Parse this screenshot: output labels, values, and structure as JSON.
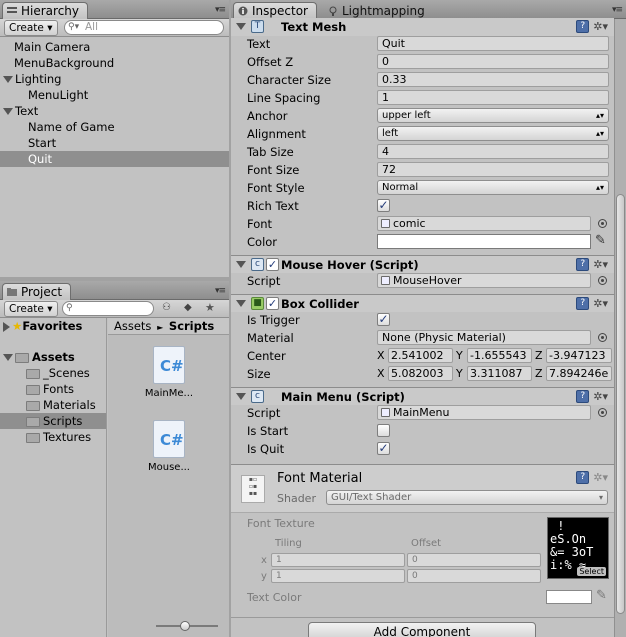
{
  "hierarchy": {
    "tab_label": "Hierarchy",
    "create_label": "Create",
    "search_placeholder": "All",
    "items": [
      {
        "label": "Main Camera"
      },
      {
        "label": "MenuBackground"
      },
      {
        "label": "Lighting"
      },
      {
        "label": "MenuLight"
      },
      {
        "label": "Text"
      },
      {
        "label": "Name of Game"
      },
      {
        "label": "Start"
      },
      {
        "label": "Quit"
      }
    ]
  },
  "project": {
    "tab_label": "Project",
    "create_label": "Create",
    "favorites_label": "Favorites",
    "assets_label": "Assets",
    "folders": [
      "_Scenes",
      "Fonts",
      "Materials",
      "Scripts",
      "Textures"
    ],
    "breadcrumb": {
      "root": "Assets",
      "separator": "►",
      "current": "Scripts"
    },
    "files": [
      "MainMe...",
      "Mouse..."
    ],
    "file_icon": "C#"
  },
  "inspector": {
    "tab_label": "Inspector",
    "other_tab_label": "Lightmapping",
    "text_mesh": {
      "title": "Text Mesh",
      "text_label": "Text",
      "text_value": "Quit",
      "offset_z_label": "Offset Z",
      "offset_z_value": "0",
      "character_size_label": "Character Size",
      "character_size_value": "0.33",
      "line_spacing_label": "Line Spacing",
      "line_spacing_value": "1",
      "anchor_label": "Anchor",
      "anchor_value": "upper left",
      "alignment_label": "Alignment",
      "alignment_value": "left",
      "tab_size_label": "Tab Size",
      "tab_size_value": "4",
      "font_size_label": "Font Size",
      "font_size_value": "72",
      "font_style_label": "Font Style",
      "font_style_value": "Normal",
      "rich_text_label": "Rich Text",
      "rich_text_checked": true,
      "font_label": "Font",
      "font_value": "comic",
      "color_label": "Color",
      "color_value": "#ffffff"
    },
    "mouse_hover": {
      "title": "Mouse Hover (Script)",
      "script_label": "Script",
      "script_value": "MouseHover"
    },
    "box_collider": {
      "title": "Box Collider",
      "is_trigger_label": "Is Trigger",
      "is_trigger_checked": true,
      "material_label": "Material",
      "material_value": "None (Physic Material)",
      "center_label": "Center",
      "center": {
        "x": "2.541002",
        "y": "-1.655543",
        "z": "-3.947123"
      },
      "size_label": "Size",
      "size": {
        "x": "5.082003",
        "y": "3.311087",
        "z": "7.894246e"
      }
    },
    "main_menu": {
      "title": "Main Menu (Script)",
      "script_label": "Script",
      "script_value": "MainMenu",
      "is_start_label": "Is Start",
      "is_start_checked": false,
      "is_quit_label": "Is Quit",
      "is_quit_checked": true
    },
    "font_material": {
      "title": "Font Material",
      "shader_label": "Shader",
      "shader_value": "GUI/Text Shader",
      "font_texture_label": "Font Texture",
      "tiling_label": "Tiling",
      "offset_label": "Offset",
      "x_label": "x",
      "y_label": "y",
      "tiling": {
        "x": "1",
        "y": "1"
      },
      "offset": {
        "x": "0",
        "y": "0"
      },
      "select_label": "Select",
      "text_color_label": "Text Color"
    },
    "add_component_label": "Add Component"
  }
}
